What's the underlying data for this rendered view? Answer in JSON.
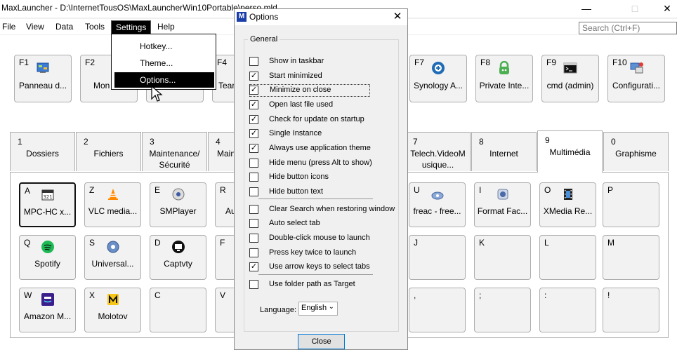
{
  "window": {
    "title": "MaxLauncher - D:\\InternetTousOS\\MaxLauncherWin10Portable\\perso.mld",
    "minimize": "—",
    "maximize": "□",
    "close": "✕"
  },
  "menu": {
    "file": "File",
    "view": "View",
    "data": "Data",
    "tools": "Tools",
    "settings": "Settings",
    "help": "Help"
  },
  "search": {
    "placeholder": "Search (Ctrl+F)"
  },
  "settings_menu": {
    "hotkey": "Hotkey...",
    "theme": "Theme...",
    "options": "Options..."
  },
  "fkeys": [
    {
      "key": "F1",
      "label": "Panneau d..."
    },
    {
      "key": "F2",
      "label": "Mon"
    },
    {
      "key": "F4",
      "label": "Tear"
    },
    {
      "key": "F7",
      "label": "Synology A..."
    },
    {
      "key": "F8",
      "label": "Private Inte..."
    },
    {
      "key": "F9",
      "label": "cmd (admin)"
    },
    {
      "key": "F10",
      "label": "Configurati..."
    }
  ],
  "tabs": [
    {
      "num": "1",
      "label": "Dossiers"
    },
    {
      "num": "2",
      "label": "Fichiers"
    },
    {
      "num": "3",
      "label": "Maintenance/ Sécurité"
    },
    {
      "num": "4",
      "label": "Main M"
    },
    {
      "num": "7",
      "label": "Telech.VideoM usique..."
    },
    {
      "num": "8",
      "label": "Internet"
    },
    {
      "num": "9",
      "label": "Multimédia"
    },
    {
      "num": "0",
      "label": "Graphisme"
    }
  ],
  "grid": {
    "A": "MPC-HC x...",
    "Z": "VLC media...",
    "E": "SMPlayer",
    "R": "Au",
    "U": "freac - free...",
    "I": "Format Fac...",
    "O": "XMedia Re...",
    "P": "",
    "Q": "Spotify",
    "S": "Universal...",
    "D": "Captvty",
    "F": "",
    "J": "",
    "K": "",
    "L": "",
    "M": "",
    "W": "Amazon M...",
    "X": "Molotov",
    "C": "",
    "V": "",
    "comma": "",
    "semicolon": "",
    "colon": "",
    "excl": ""
  },
  "grid_keys": {
    "A": "A",
    "Z": "Z",
    "E": "E",
    "R": "R",
    "U": "U",
    "I": "I",
    "O": "O",
    "P": "P",
    "Q": "Q",
    "S": "S",
    "D": "D",
    "F": "F",
    "J": "J",
    "K": "K",
    "L": "L",
    "M": "M",
    "W": "W",
    "X": "X",
    "C": "C",
    "V": "V",
    "comma": ",",
    "semicolon": ";",
    "colon": ":",
    "excl": "!"
  },
  "dialog": {
    "title": "Options",
    "close": "✕",
    "group": "General",
    "options": [
      {
        "label": "Show in taskbar",
        "checked": false
      },
      {
        "label": "Start minimized",
        "checked": true
      },
      {
        "label": "Minimize on close",
        "checked": true
      },
      {
        "label": "Open last file used",
        "checked": true
      },
      {
        "label": "Check for update on startup",
        "checked": true
      },
      {
        "label": "Single Instance",
        "checked": true
      },
      {
        "label": "Always use application theme",
        "checked": true
      },
      {
        "label": "Hide menu (press Alt to show)",
        "checked": false
      },
      {
        "label": "Hide button icons",
        "checked": false
      },
      {
        "label": "Hide button text",
        "checked": false
      },
      {
        "label": "Clear Search when restoring window",
        "checked": false
      },
      {
        "label": "Auto select tab",
        "checked": false
      },
      {
        "label": "Double-click mouse to launch",
        "checked": false
      },
      {
        "label": "Press key twice to launch",
        "checked": false
      },
      {
        "label": "Use arrow keys to select tabs",
        "checked": true
      },
      {
        "label": "Use folder path as Target",
        "checked": false
      }
    ],
    "language_label": "Language:",
    "language_value": "English",
    "close_button": "Close"
  }
}
